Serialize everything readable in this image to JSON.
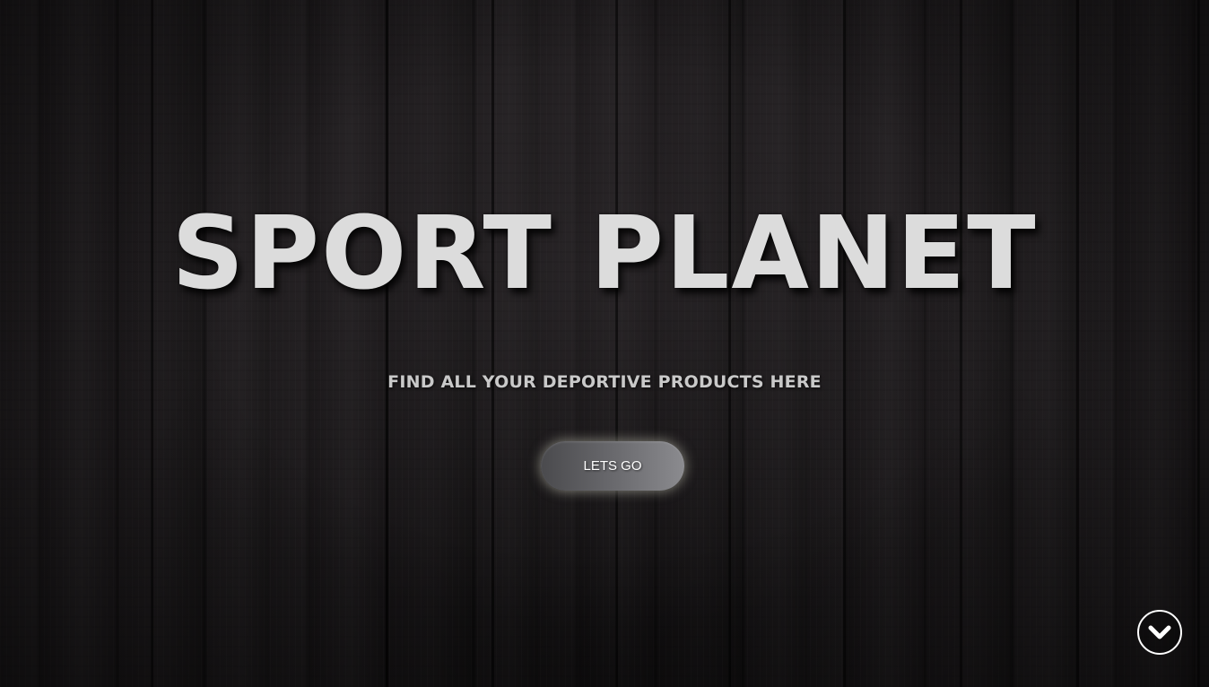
{
  "hero": {
    "title": "SPORT PLANET",
    "subtitle": "FIND ALL YOUR DEPORTIVE PRODUCTS HERE",
    "cta_label": "LETS GO",
    "scroll_icon": "chevron-down-circle-icon"
  },
  "colors": {
    "background": "#1b181a",
    "title": "#dcdcdc",
    "subtitle": "#c9c9c9",
    "button_start": "#4a4a4d",
    "button_end": "#8b8b8f",
    "button_text": "#ffffff"
  }
}
